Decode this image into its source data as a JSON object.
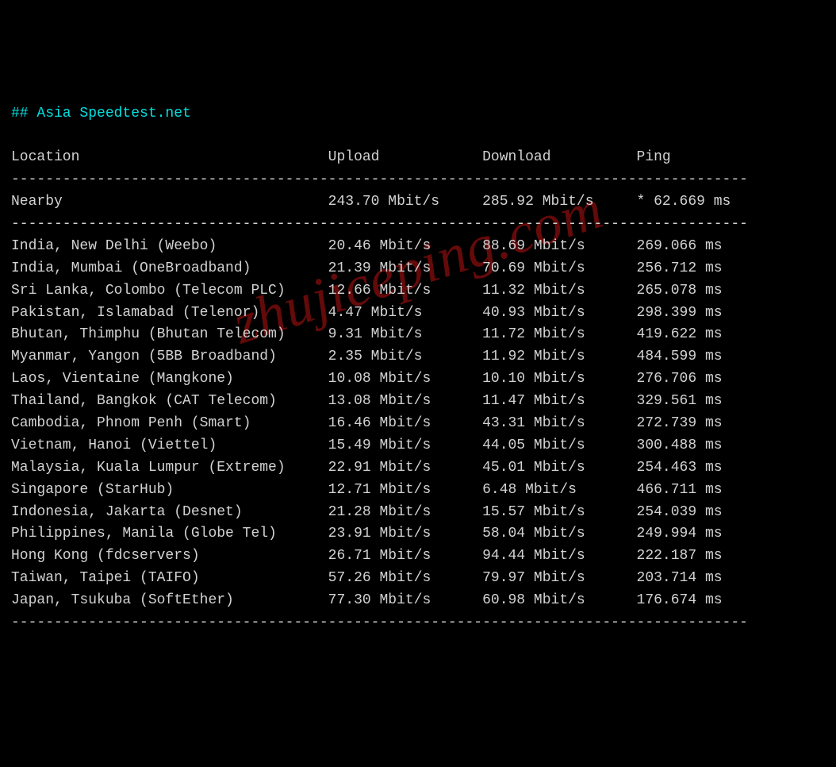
{
  "title": "## Asia Speedtest.net",
  "watermark": "zhujiceping.com",
  "columns": {
    "location": "Location",
    "upload": "Upload",
    "download": "Download",
    "ping": "Ping"
  },
  "col_widths": {
    "location": 37,
    "upload": 18,
    "download": 18
  },
  "nearby": {
    "location": "Nearby",
    "upload": "243.70 Mbit/s",
    "download": "285.92 Mbit/s",
    "ping": "* 62.669 ms"
  },
  "rows": [
    {
      "location": "India, New Delhi (Weebo)",
      "upload": "20.46 Mbit/s",
      "download": "88.69 Mbit/s",
      "ping": "269.066 ms"
    },
    {
      "location": "India, Mumbai (OneBroadband)",
      "upload": "21.39 Mbit/s",
      "download": "70.69 Mbit/s",
      "ping": "256.712 ms"
    },
    {
      "location": "Sri Lanka, Colombo (Telecom PLC)",
      "upload": "12.66 Mbit/s",
      "download": "11.32 Mbit/s",
      "ping": "265.078 ms"
    },
    {
      "location": "Pakistan, Islamabad (Telenor)",
      "upload": "4.47 Mbit/s",
      "download": "40.93 Mbit/s",
      "ping": "298.399 ms"
    },
    {
      "location": "Bhutan, Thimphu (Bhutan Telecom)",
      "upload": "9.31 Mbit/s",
      "download": "11.72 Mbit/s",
      "ping": "419.622 ms"
    },
    {
      "location": "Myanmar, Yangon (5BB Broadband)",
      "upload": "2.35 Mbit/s",
      "download": "11.92 Mbit/s",
      "ping": "484.599 ms"
    },
    {
      "location": "Laos, Vientaine (Mangkone)",
      "upload": "10.08 Mbit/s",
      "download": "10.10 Mbit/s",
      "ping": "276.706 ms"
    },
    {
      "location": "Thailand, Bangkok (CAT Telecom)",
      "upload": "13.08 Mbit/s",
      "download": "11.47 Mbit/s",
      "ping": "329.561 ms"
    },
    {
      "location": "Cambodia, Phnom Penh (Smart)",
      "upload": "16.46 Mbit/s",
      "download": "43.31 Mbit/s",
      "ping": "272.739 ms"
    },
    {
      "location": "Vietnam, Hanoi (Viettel)",
      "upload": "15.49 Mbit/s",
      "download": "44.05 Mbit/s",
      "ping": "300.488 ms"
    },
    {
      "location": "Malaysia, Kuala Lumpur (Extreme)",
      "upload": "22.91 Mbit/s",
      "download": "45.01 Mbit/s",
      "ping": "254.463 ms"
    },
    {
      "location": "Singapore (StarHub)",
      "upload": "12.71 Mbit/s",
      "download": "6.48 Mbit/s",
      "ping": "466.711 ms"
    },
    {
      "location": "Indonesia, Jakarta (Desnet)",
      "upload": "21.28 Mbit/s",
      "download": "15.57 Mbit/s",
      "ping": "254.039 ms"
    },
    {
      "location": "Philippines, Manila (Globe Tel)",
      "upload": "23.91 Mbit/s",
      "download": "58.04 Mbit/s",
      "ping": "249.994 ms"
    },
    {
      "location": "Hong Kong (fdcservers)",
      "upload": "26.71 Mbit/s",
      "download": "94.44 Mbit/s",
      "ping": "222.187 ms"
    },
    {
      "location": "Taiwan, Taipei (TAIFO)",
      "upload": "57.26 Mbit/s",
      "download": "79.97 Mbit/s",
      "ping": "203.714 ms"
    },
    {
      "location": "Japan, Tsukuba (SoftEther)",
      "upload": "77.30 Mbit/s",
      "download": "60.98 Mbit/s",
      "ping": "176.674 ms"
    }
  ],
  "divider_width": 86
}
